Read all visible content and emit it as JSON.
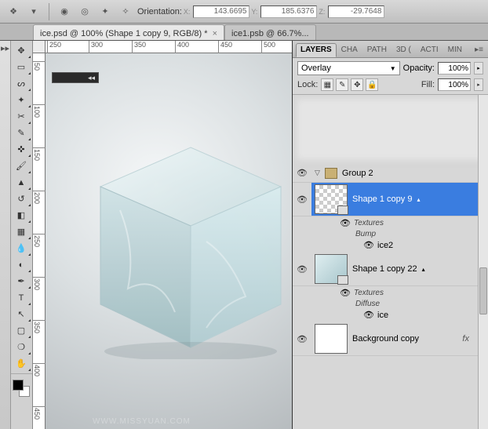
{
  "topbar": {
    "orientation_label": "Orientation:",
    "x_label": "X:",
    "x_value": "143.6695",
    "y_label": "Y:",
    "y_value": "185.6376",
    "z_label": "Z:",
    "z_value": "-29.7648"
  },
  "tabs": {
    "active": "ice.psd @ 100% (Shape 1 copy 9, RGB/8) *",
    "inactive": "ice1.psb @ 66.7%..."
  },
  "ruler_h": [
    "250",
    "300",
    "350",
    "400",
    "450",
    "500"
  ],
  "ruler_v": [
    "50",
    "100",
    "150",
    "200",
    "250",
    "300",
    "350",
    "400",
    "450"
  ],
  "panels": {
    "tabs": [
      "LAYERS",
      "CHA",
      "PATH",
      "3D (",
      "ACTI",
      "MIN"
    ],
    "active_tab": 0,
    "blend_mode": "Overlay",
    "opacity_label": "Opacity:",
    "opacity_value": "100%",
    "lock_label": "Lock:",
    "fill_label": "Fill:",
    "fill_value": "100%"
  },
  "layers": {
    "group": "Group 2",
    "shape9": "Shape 1 copy 9",
    "textures": "Textures",
    "bump": "Bump",
    "ice2": "ice2",
    "shape22": "Shape 1 copy 22",
    "diffuse": "Diffuse",
    "ice": "ice",
    "bgcopy": "Background copy",
    "fx": "fx"
  },
  "watermark": "WWW.MISSYUAN.COM"
}
